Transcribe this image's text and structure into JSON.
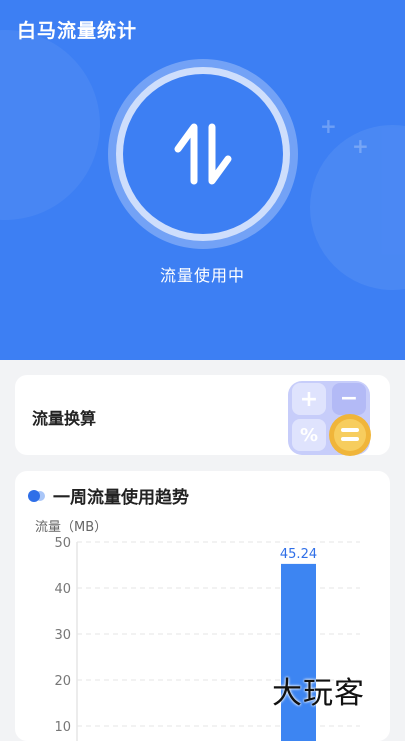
{
  "app": {
    "title": "白马流量统计"
  },
  "hero": {
    "status": "流量使用中",
    "icon": "up-down-arrows-icon"
  },
  "conversion": {
    "label": "流量换算",
    "icon": "calculator-icon"
  },
  "weekly": {
    "title": "一周流量使用趋势",
    "unit_label": "流量（MB）"
  },
  "chart_data": {
    "type": "bar",
    "ylabel": "流量（MB）",
    "ylim": [
      0,
      50
    ],
    "yticks": [
      10,
      20,
      30,
      40,
      50
    ],
    "bars": [
      {
        "value": 45.24,
        "label": "45.24"
      }
    ],
    "grid": true,
    "bar_color": "#3d85f2"
  },
  "watermark": "大玩客",
  "colors": {
    "primary": "#3d7ff3",
    "bar": "#3d85f2"
  }
}
